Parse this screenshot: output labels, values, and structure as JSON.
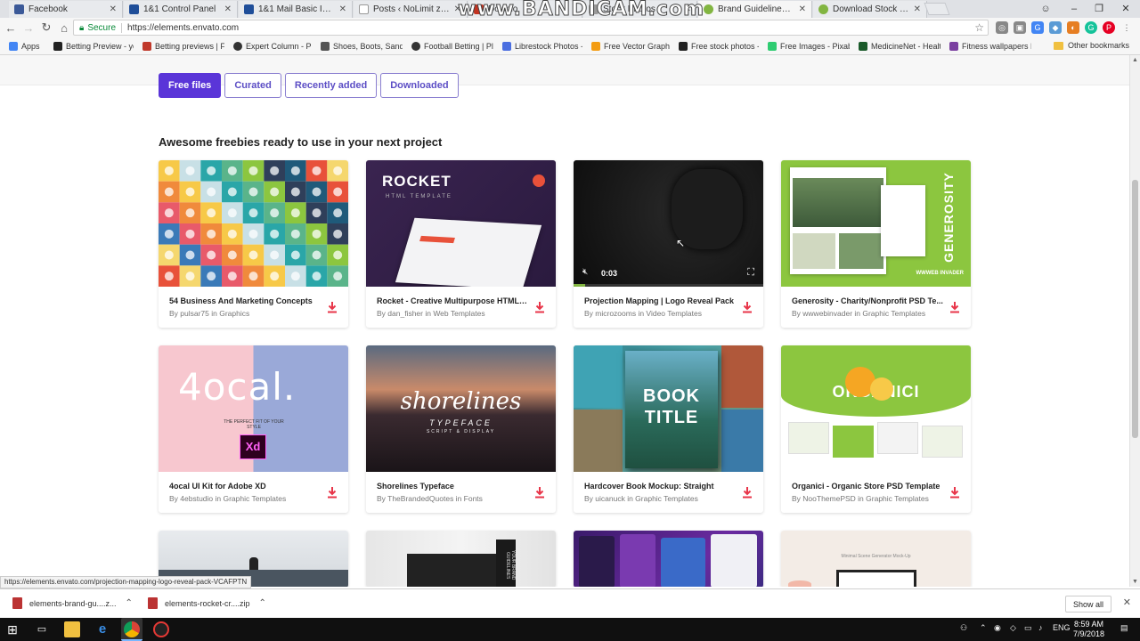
{
  "browser": {
    "tabs": [
      {
        "label": "Facebook",
        "color": "#3b5998"
      },
      {
        "label": "1&1 Control Panel",
        "color": "#1f4e99"
      },
      {
        "label": "1&1 Mail Basic Inbox",
        "color": "#1f4e99"
      },
      {
        "label": "Posts ‹ NoLimit zone — W",
        "color": "#777777"
      },
      {
        "label": "Downlo",
        "color": "#c23321"
      },
      {
        "label": "Stock Photos",
        "color": "#999999"
      },
      {
        "label": "Brand Guidelines by RWG",
        "color": "#82b541"
      },
      {
        "label": "Download Stock Photos",
        "color": "#82b541"
      }
    ],
    "watermark": "www.BANDICAM.com",
    "secure_label": "Secure",
    "url": "https://elements.envato.com",
    "bookmarks": [
      {
        "label": "Apps",
        "color": "#4285f4"
      },
      {
        "label": "Betting Preview - yo",
        "color": "#222222"
      },
      {
        "label": "Betting previews | Fo",
        "color": "#c0392b"
      },
      {
        "label": "Expert Column - Pre",
        "color": "#333333"
      },
      {
        "label": "Shoes, Boots, Sanda",
        "color": "#555555"
      },
      {
        "label": "Football Betting | Pla",
        "color": "#333333"
      },
      {
        "label": "Librestock Photos -",
        "color": "#4a6ee0"
      },
      {
        "label": "Free Vector Graphics",
        "color": "#f39c12"
      },
      {
        "label": "Free stock photos - P",
        "color": "#222222"
      },
      {
        "label": "Free Images - Pixaba",
        "color": "#2ecc71"
      },
      {
        "label": "MedicineNet - Healt",
        "color": "#1a5a2a"
      },
      {
        "label": "Fitness wallpapers H",
        "color": "#7a3fa0"
      }
    ],
    "other_bookmarks": "Other bookmarks"
  },
  "filters": [
    {
      "label": "Free files",
      "active": true
    },
    {
      "label": "Curated",
      "active": false
    },
    {
      "label": "Recently added",
      "active": false
    },
    {
      "label": "Downloaded",
      "active": false
    }
  ],
  "heading": "Awesome freebies ready to use in your next project",
  "cards": [
    {
      "title": "54 Business And Marketing Concepts",
      "byline": "By pulsar75 in Graphics"
    },
    {
      "title": "Rocket - Creative Multipurpose HTML T...",
      "byline": "By dan_fisher in Web Templates",
      "thumb_title": "ROCKET",
      "thumb_sub": "HTML TEMPLATE"
    },
    {
      "title": "Projection Mapping | Logo Reveal Pack",
      "byline": "By microzooms in Video Templates",
      "video_time": "0:03"
    },
    {
      "title": "Generosity - Charity/Nonprofit PSD Te...",
      "byline": "By wwwebinvader in Graphic Templates",
      "thumb_title": "GENEROSITY",
      "thumb_sub": "WWWEB INVADER"
    },
    {
      "title": "4ocal UI Kit for Adobe XD",
      "byline": "By 4ebstudio in Graphic Templates",
      "thumb_title": "4ocal.",
      "thumb_sub": "THE PERFECT FIT OF YOUR STYLE",
      "badge": "Xd"
    },
    {
      "title": "Shorelines Typeface",
      "byline": "By TheBrandedQuotes in Fonts",
      "thumb_title": "shorelines",
      "thumb_sub": "TYPEFACE",
      "thumb_sub2": "SCRIPT & DISPLAY"
    },
    {
      "title": "Hardcover Book Mockup: Straight",
      "byline": "By uicanuck in Graphic Templates",
      "thumb_title": "BOOK",
      "thumb_sub": "TITLE"
    },
    {
      "title": "Organici - Organic Store PSD Template",
      "byline": "By NooThemePSD in Graphic Templates",
      "thumb_title": "ORGANICI"
    },
    {
      "title": "",
      "byline": ""
    },
    {
      "title": "",
      "byline": "",
      "thumb_title": "YOUR BRAND GUIDELINES"
    },
    {
      "title": "",
      "byline": ""
    },
    {
      "title": "",
      "byline": "",
      "thumb_title": "Minimal Scene Generator Mock-Up"
    }
  ],
  "status_url": "https://elements.envato.com/projection-mapping-logo-reveal-pack-VCAFPTN",
  "downloads": [
    {
      "label": "elements-brand-gu....z..."
    },
    {
      "label": "elements-rocket-cr....zip"
    }
  ],
  "show_all": "Show all",
  "taskbar": {
    "lang": "ENG",
    "time": "8:59 AM",
    "date": "7/9/2018"
  }
}
